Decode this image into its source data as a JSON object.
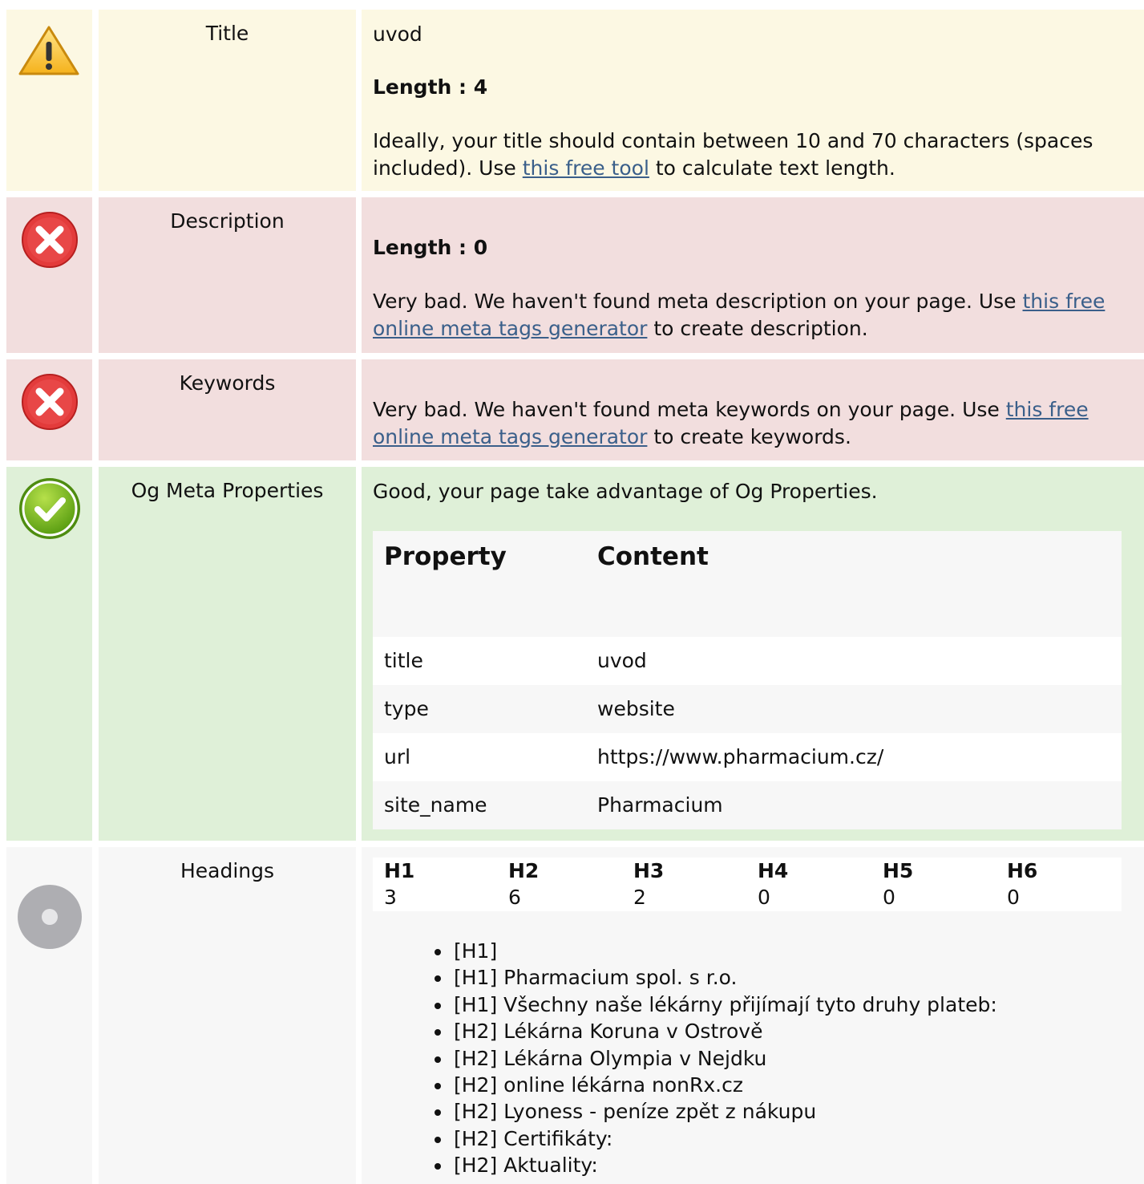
{
  "colors": {
    "warning_bg": "#fcf8e3",
    "error_bg": "#f2dede",
    "success_bg": "#dff0d8",
    "neutral_bg": "#f7f7f7",
    "link": "#3a5f8a"
  },
  "rows": {
    "title": {
      "icon": "warning-icon",
      "label": "Title",
      "value": "uvod",
      "length_label": "Length : 4",
      "message_before": "Ideally, your title should contain between 10 and 70 characters (spaces included). Use ",
      "link_text": "this free tool",
      "message_after": " to calculate text length."
    },
    "description": {
      "icon": "error-icon",
      "label": "Description",
      "length_label": "Length : 0",
      "message_before": "Very bad. We haven't found meta description on your page. Use ",
      "link_text": "this free online meta tags generator",
      "message_after": " to create description."
    },
    "keywords": {
      "icon": "error-icon",
      "label": "Keywords",
      "message_before": "Very bad. We haven't found meta keywords on your page. Use ",
      "link_text": "this free online meta tags generator",
      "message_after": " to create keywords."
    },
    "og": {
      "icon": "success-icon",
      "label": "Og Meta Properties",
      "message": "Good, your page take advantage of Og Properties.",
      "table_headers": [
        "Property",
        "Content"
      ],
      "table_rows": [
        {
          "property": "title",
          "content": "uvod"
        },
        {
          "property": "type",
          "content": "website"
        },
        {
          "property": "url",
          "content": "https://www.pharmacium.cz/"
        },
        {
          "property": "site_name",
          "content": "Pharmacium"
        }
      ]
    },
    "headings": {
      "icon": "neutral-icon",
      "label": "Headings",
      "counts": [
        {
          "tag": "H1",
          "count": "3"
        },
        {
          "tag": "H2",
          "count": "6"
        },
        {
          "tag": "H3",
          "count": "2"
        },
        {
          "tag": "H4",
          "count": "0"
        },
        {
          "tag": "H5",
          "count": "0"
        },
        {
          "tag": "H6",
          "count": "0"
        }
      ],
      "list": [
        "[H1]",
        "[H1] Pharmacium spol. s r.o.",
        "[H1] Všechny naše lékárny přijímají tyto druhy plateb:",
        "[H2] Lékárna Koruna v Ostrově",
        "[H2] Lékárna Olympia v Nejdku",
        "[H2] online lékárna nonRx.cz",
        "[H2] Lyoness - peníze zpět z nákupu",
        "[H2] Certifikáty:",
        "[H2] Aktuality:"
      ]
    }
  }
}
